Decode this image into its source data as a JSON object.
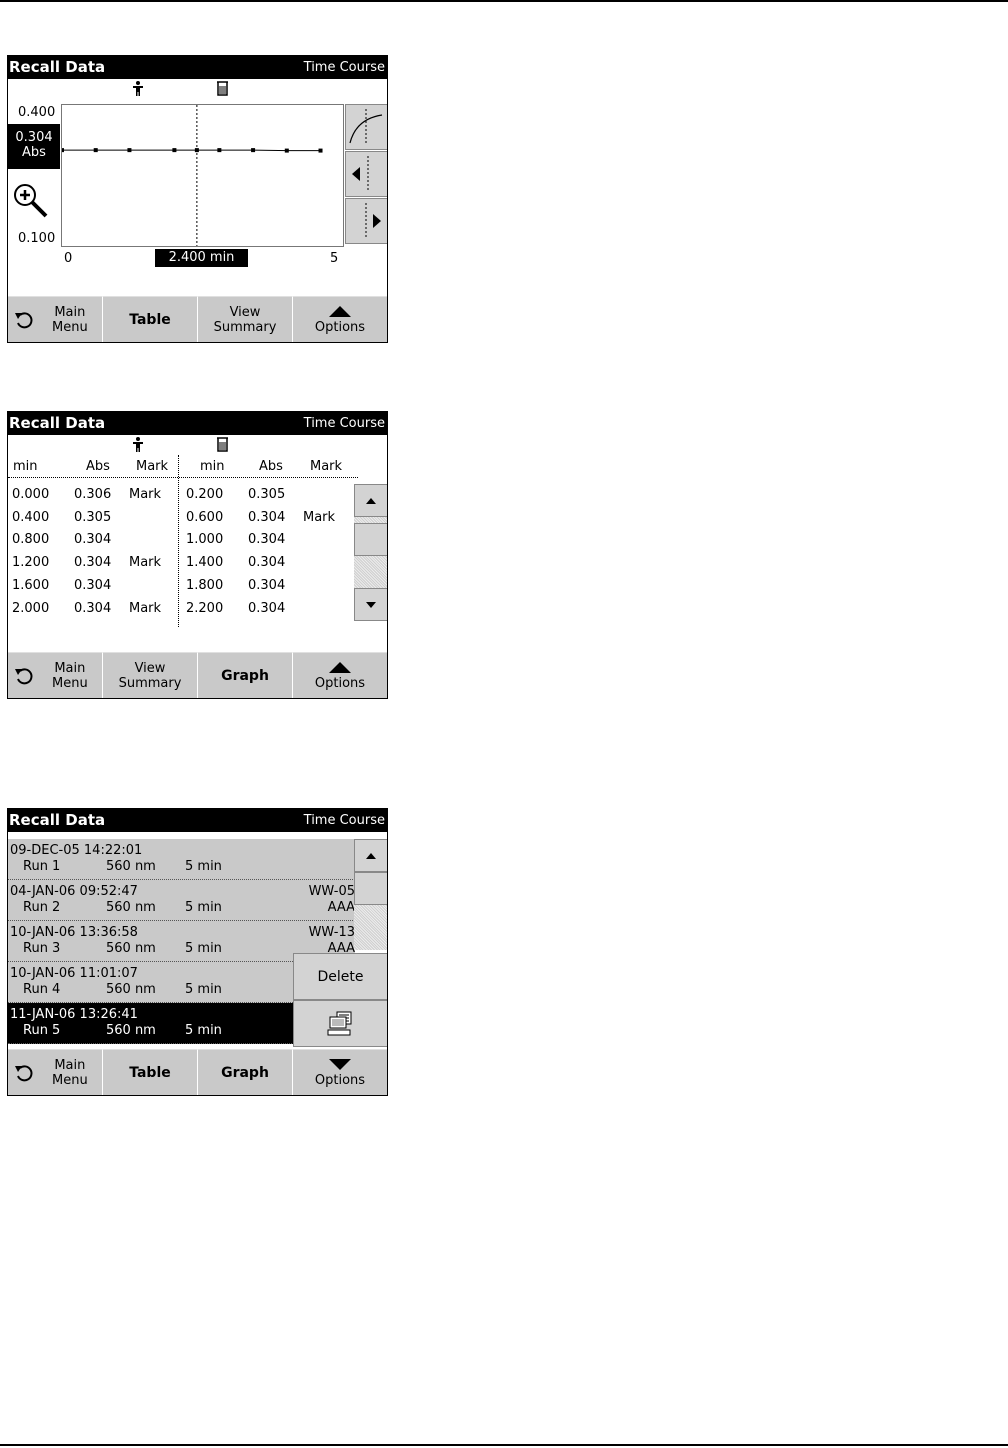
{
  "colors": {
    "title_bg": "#000000",
    "button_bg": "#c9c9c9",
    "panel_bg": "#d3d3d3"
  },
  "graph_screen": {
    "title": "Recall Data",
    "mode": "Time Course",
    "user_icon": "person-icon",
    "sample_icon": "beaker-icon",
    "y_max": "0.400",
    "y_min": "0.100",
    "cursor_value": "0.304",
    "cursor_unit": "Abs",
    "x_min": "0",
    "x_max": "5",
    "cursor_x": "2.400 min",
    "side_buttons": [
      "curve-fit-icon",
      "cursor-left-icon",
      "cursor-right-icon"
    ],
    "buttons": {
      "main_menu_1": "Main",
      "main_menu_2": "Menu",
      "table": "Table",
      "summary_1": "View",
      "summary_2": "Summary",
      "options": "Options"
    }
  },
  "chart_data": {
    "type": "line",
    "x": [
      0.0,
      0.6,
      1.2,
      2.0,
      2.4,
      2.8,
      3.4,
      4.0,
      4.6
    ],
    "values": [
      0.304,
      0.304,
      0.304,
      0.304,
      0.304,
      0.304,
      0.304,
      0.303,
      0.303
    ],
    "xlim": [
      0,
      5
    ],
    "ylim": [
      0.1,
      0.4
    ],
    "cursor_x": 2.4
  },
  "table_screen": {
    "title": "Recall Data",
    "mode": "Time Course",
    "headers": [
      "min",
      "Abs",
      "Mark",
      "min",
      "Abs",
      "Mark"
    ],
    "rows": [
      [
        "0.000",
        "0.306",
        "Mark",
        "0.200",
        "0.305",
        ""
      ],
      [
        "0.400",
        "0.305",
        "",
        "0.600",
        "0.304",
        "Mark"
      ],
      [
        "0.800",
        "0.304",
        "",
        "1.000",
        "0.304",
        ""
      ],
      [
        "1.200",
        "0.304",
        "Mark",
        "1.400",
        "0.304",
        ""
      ],
      [
        "1.600",
        "0.304",
        "",
        "1.800",
        "0.304",
        ""
      ],
      [
        "2.000",
        "0.304",
        "Mark",
        "2.200",
        "0.304",
        ""
      ]
    ],
    "scroll_position": 0.15,
    "buttons": {
      "main_menu_1": "Main",
      "main_menu_2": "Menu",
      "summary_1": "View",
      "summary_2": "Summary",
      "graph": "Graph",
      "options": "Options"
    }
  },
  "list_screen": {
    "title": "Recall Data",
    "mode": "Time Course",
    "rows": [
      {
        "datetime": "09-DEC-05  14:22:01",
        "run": "Run 1",
        "nm": "560 nm",
        "min": "5 min",
        "id": "",
        "note": ""
      },
      {
        "datetime": "04-JAN-06  09:52:47",
        "run": "Run 2",
        "nm": "560 nm",
        "min": "5 min",
        "id": "WW-05",
        "note": "AAA"
      },
      {
        "datetime": "10-JAN-06  13:36:58",
        "run": "Run 3",
        "nm": "560 nm",
        "min": "5 min",
        "id": "WW-13",
        "note": "AAA"
      },
      {
        "datetime": "10-JAN-06  11:01:07",
        "run": "Run 4",
        "nm": "560 nm",
        "min": "5 min",
        "id": "",
        "note": ""
      },
      {
        "datetime": "11-JAN-06  13:26:41",
        "run": "Run 5",
        "nm": "560 nm",
        "min": "5 min",
        "id": "",
        "note": ""
      }
    ],
    "selected_index": 4,
    "popup": {
      "delete": "Delete",
      "send_icon": "computer-icon"
    },
    "buttons": {
      "main_menu_1": "Main",
      "main_menu_2": "Menu",
      "table": "Table",
      "graph": "Graph",
      "options": "Options"
    }
  }
}
